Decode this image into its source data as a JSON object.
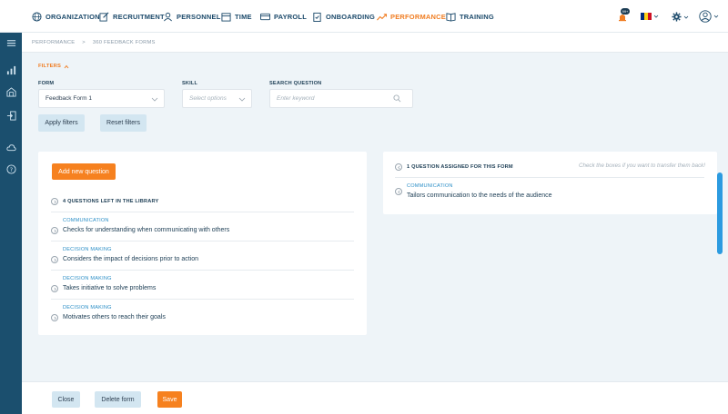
{
  "nav": {
    "items": [
      {
        "key": "organization",
        "label": "ORGANIZATION",
        "icon": "globe-icon"
      },
      {
        "key": "recruitment",
        "label": "RECRUITMENT",
        "icon": "edit-icon"
      },
      {
        "key": "personnel",
        "label": "PERSONNEL",
        "icon": "user-icon"
      },
      {
        "key": "time",
        "label": "TIME",
        "icon": "calendar-icon"
      },
      {
        "key": "payroll",
        "label": "PAYROLL",
        "icon": "card-icon"
      },
      {
        "key": "onboarding",
        "label": "ONBOARDING",
        "icon": "clipboard-icon"
      },
      {
        "key": "performance",
        "label": "PERFORMANCE",
        "icon": "trend-icon"
      },
      {
        "key": "training",
        "label": "TRAINING",
        "icon": "book-icon"
      }
    ],
    "notification_badge": "99+",
    "accent": "#f07d22",
    "nav_color": "#1c4a6b"
  },
  "breadcrumb": {
    "parent": "PERFORMANCE",
    "separator": ">",
    "current": "360 FEEDBACK FORMS"
  },
  "filters": {
    "toggle_label": "FILTERS",
    "form_label": "FORM",
    "form_value": "Feedback Form 1",
    "skill_label": "SKILL",
    "skill_placeholder": "Select options",
    "search_label": "SEARCH QUESTION",
    "search_placeholder": "Enter keyword",
    "apply_label": "Apply filters",
    "reset_label": "Reset filters"
  },
  "library": {
    "add_label": "Add new question",
    "header": "4 QUESTIONS LEFT IN THE LIBRARY",
    "questions": [
      {
        "category": "COMMUNICATION",
        "text": "Checks for understanding when communicating with others"
      },
      {
        "category": "DECISION MAKING",
        "text": "Considers the impact of decisions prior to action"
      },
      {
        "category": "DECISION MAKING",
        "text": "Takes initiative to solve problems"
      },
      {
        "category": "DECISION MAKING",
        "text": "Motivates others to reach their goals"
      }
    ]
  },
  "assigned": {
    "header": "1 QUESTION ASSIGNED FOR THIS FORM",
    "hint": "Check the boxes if you want to transfer them back!",
    "questions": [
      {
        "category": "COMMUNICATION",
        "text": "Tailors communication to the needs of the audience"
      }
    ]
  },
  "footer": {
    "close_label": "Close",
    "delete_label": "Delete form",
    "save_label": "Save"
  },
  "sidebar": {
    "icons": [
      "menu-icon",
      "chart-icon",
      "building-icon",
      "login-icon",
      "cloud-icon",
      "help-icon"
    ]
  },
  "colors": {
    "orange": "#f6811f",
    "light_button": "#d3e6f1",
    "category_blue": "#2c8fc7",
    "sidebar": "#1b4f6e"
  }
}
